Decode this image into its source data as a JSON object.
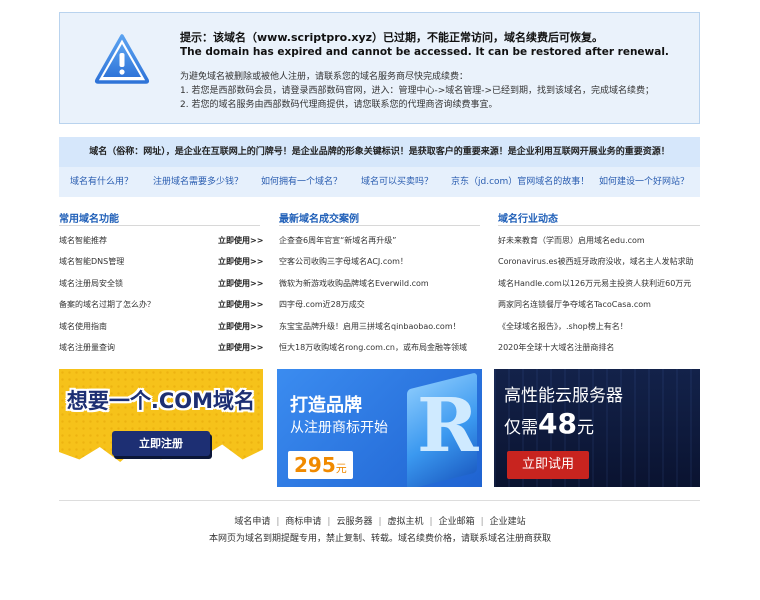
{
  "notice": {
    "title": "提示：该域名（www.scriptpro.xyz）已过期，不能正常访问，域名续费后可恢复。",
    "english": "The domain has expired and cannot be accessed. It can be restored after renewal.",
    "lines": [
      "为避免域名被删除或被他人注册，请联系您的域名服务商尽快完成续费：",
      "1. 若您是西部数码会员，请登录西部数码官网，进入：管理中心->域名管理->已经到期，找到该域名，完成域名续费；",
      "2. 若您的域名服务由西部数码代理商提供，请您联系您的代理商咨询续费事宜。"
    ]
  },
  "slogan": "域名（俗称：网址），是企业在互联网上的门牌号！是企业品牌的形象关键标识！是获取客户的重要来源！是企业利用互联网开展业务的重要资源！",
  "faq": [
    "域名有什么用？",
    "注册域名需要多少钱？",
    "如何拥有一个域名？",
    "域名可以买卖吗？",
    "京东（jd.com）官网域名的故事！",
    "如何建设一个好网站？"
  ],
  "columns": {
    "features": {
      "title": "常用域名功能",
      "items": [
        "域名智能推荐",
        "域名智能DNS管理",
        "域名注册局安全锁",
        "备案的域名过期了怎么办？",
        "域名使用指南",
        "域名注册量查询"
      ],
      "action": "立即使用>>"
    },
    "cases": {
      "title": "最新域名成交案例",
      "items": [
        "企查查6周年官宣“新域名再升级”",
        "空客公司收购三字母域名ACJ.com！",
        "微软为新游戏收购品牌域名Everwild.com",
        "四字母.com近28万成交",
        "东宝宝品牌升级！启用三拼域名qinbaobao.com！",
        "恒大18万收购域名rong.com.cn，或布局金融等领域"
      ]
    },
    "news": {
      "title": "域名行业动态",
      "items": [
        "好未来教育（学而思）启用域名edu.com",
        "Coronavirus.es被西班牙政府没收，域名主人发帖求助",
        "域名Handle.com以126万元易主投资人获利近60万元",
        "两家同名连锁餐厅争夺域名TacoCasa.com",
        "《全球域名报告》，.shop榜上有名！",
        "2020年全球十大域名注册商排名"
      ]
    }
  },
  "banners": {
    "com": {
      "headline": "想要一个.COM域名",
      "button": "立即注册"
    },
    "brand": {
      "headline": "打造品牌",
      "sub": "从注册商标开始",
      "price": "295",
      "unit": "元",
      "glyph": "R"
    },
    "cloud": {
      "headline": "高性能云服务器",
      "prefix": "仅需",
      "price": "48",
      "unit": "元",
      "button": "立即试用"
    }
  },
  "footer": {
    "links": [
      "域名申请",
      "商标申请",
      "云服务器",
      "虚拟主机",
      "企业邮箱",
      "企业建站"
    ],
    "separator": "|",
    "copyright": "本网页为域名到期提醒专用，禁止复制、转载。域名续费价格，请联系域名注册商获取"
  },
  "colors": {
    "notice_bg": "#eaf2fb",
    "notice_border": "#b9d3ee",
    "slogan_bg": "#d6e7fb",
    "faq_bg": "#e6f0fc",
    "link_blue": "#2a5db0",
    "column_title_blue": "#1f5fb8",
    "banner_yellow": "#f6c21a",
    "banner_blue": "#2f7fe6",
    "banner_dark": "#0e1a3a",
    "trial_red": "#c8241f"
  }
}
